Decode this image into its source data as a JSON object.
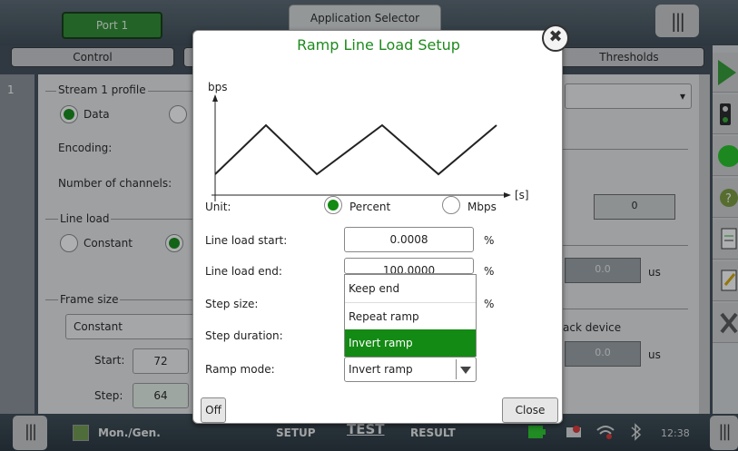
{
  "header": {
    "port_tab": "Port 1",
    "app_selector": "Application Selector",
    "tabs": [
      "Control",
      "Thresholds"
    ]
  },
  "stream": {
    "number": "1",
    "profile_title": "Stream 1 profile",
    "data_label": "Data",
    "encoding_label": "Encoding:",
    "channels_label": "Number of channels:",
    "line_load_title": "Line load",
    "constant_label": "Constant",
    "frame_size_title": "Frame size",
    "frame_size_value": "Constant",
    "start_label": "Start:",
    "start_value": "72",
    "step_label": "Step:",
    "step_value": "64"
  },
  "right": {
    "field1": "0",
    "field2": "0.0",
    "unit2": "us",
    "back_device": "ack device",
    "field3": "0.0",
    "unit3": "us"
  },
  "dialog": {
    "title": "Ramp Line Load Setup",
    "chart_y_label": "bps",
    "chart_x_label": "[s]",
    "unit_label": "Unit:",
    "unit_percent": "Percent",
    "unit_mbps": "Mbps",
    "start_label": "Line load start:",
    "start_value": "0.0008",
    "start_unit": "%",
    "end_label": "Line load end:",
    "end_value": "100.0000",
    "end_unit": "%",
    "step_size_label": "Step size:",
    "step_size_unit": "%",
    "step_duration_label": "Step duration:",
    "ramp_mode_label": "Ramp mode:",
    "ramp_mode_value": "Invert ramp",
    "options": [
      "Keep end",
      "Repeat ramp",
      "Invert ramp"
    ],
    "off_button": "Off",
    "close_button": "Close"
  },
  "footer": {
    "app_name": "Mon./Gen.",
    "setup": "SETUP",
    "test": "TEST",
    "result": "RESULT",
    "time": "12:38"
  },
  "colors": {
    "accent_green": "#138a13",
    "title_green": "#1e8a1e"
  }
}
